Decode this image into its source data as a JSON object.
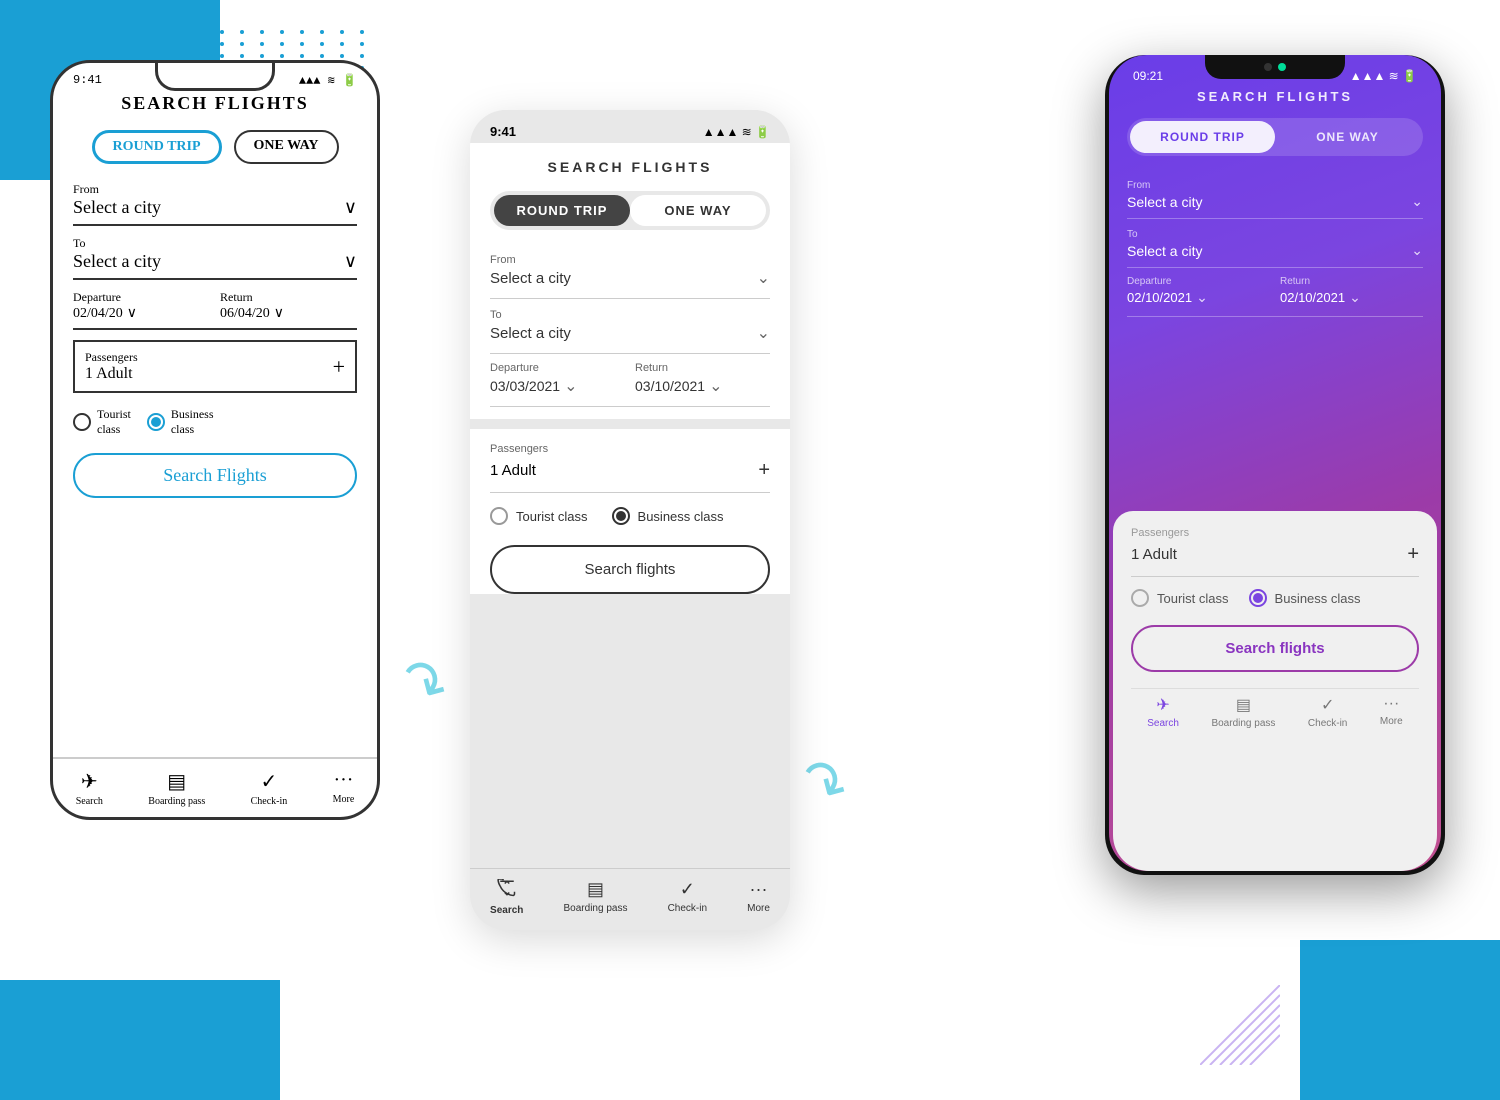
{
  "page": {
    "background": "#ffffff"
  },
  "phone_wireframe": {
    "status_time": "9:41",
    "title": "SEARCH FLIGHTS",
    "toggle": {
      "round_trip": "ROUND TRIP",
      "one_way": "ONE WAY"
    },
    "from_label": "From",
    "from_value": "Select a city",
    "to_label": "To",
    "to_value": "Select a city",
    "departure_label": "Departure",
    "departure_value": "02/04/20",
    "return_label": "Return",
    "return_value": "06/04/20",
    "passengers_label": "Passengers",
    "passengers_value": "1 Adult",
    "class_tourist": "Tourist class",
    "class_business": "Business class",
    "search_btn": "Search Flights",
    "nav": {
      "search": "Search",
      "boarding": "Boarding pass",
      "checkin": "Check-in",
      "more": "More"
    }
  },
  "phone_mid": {
    "status_time": "9:41",
    "title": "SEARCH FLIGHTS",
    "toggle": {
      "round_trip": "ROUND TRIP",
      "one_way": "ONE WAY"
    },
    "from_label": "From",
    "from_value": "Select a city",
    "to_label": "To",
    "to_value": "Select a city",
    "departure_label": "Departure",
    "departure_value": "03/03/2021",
    "return_label": "Return",
    "return_value": "03/10/2021",
    "passengers_label": "Passengers",
    "passengers_value": "1 Adult",
    "class_tourist": "Tourist class",
    "class_business": "Business class",
    "search_btn": "Search flights",
    "nav": {
      "search": "Search",
      "boarding": "Boarding pass",
      "checkin": "Check-in",
      "more": "More"
    }
  },
  "phone_final": {
    "status_time": "09:21",
    "title": "SEARCH FLIGHTS",
    "toggle": {
      "round_trip": "ROUND TRIP",
      "one_way": "ONE WAY"
    },
    "from_label": "From",
    "from_value": "Select a city",
    "to_label": "To",
    "to_value": "Select a city",
    "departure_label": "Departure",
    "departure_value": "02/10/2021",
    "return_label": "Return",
    "return_value": "02/10/2021",
    "passengers_label": "Passengers",
    "passengers_value": "1 Adult",
    "class_tourist": "Tourist class",
    "class_business": "Business class",
    "search_btn": "Search flights",
    "nav": {
      "search": "Search",
      "boarding": "Boarding pass",
      "checkin": "Check-in",
      "more": "More"
    }
  },
  "arrows": {
    "arrow1_symbol": "↳",
    "arrow2_symbol": "↳"
  }
}
